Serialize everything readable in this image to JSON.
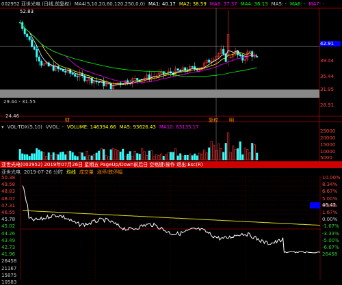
{
  "kline": {
    "stock": "002952 亚世光电 (日线,前复权)",
    "ma4": "MA4(5,10,20,60,120,250,0,0)",
    "ma1": "MA1: 40.17",
    "ma2": "MA2: 38.59",
    "ma3": "MA3: 37.37",
    "ma4v": "MA4: 36.13",
    "ma5": "MA5: -",
    "ma6": "MA6: -",
    "ma7": "MA7: -",
    "high_mark": "52.83",
    "low_mark": "24.46",
    "range_mark": "29.44 - 31.55",
    "price_axis": [
      "42.91",
      "39.44",
      "35.44",
      "31.95",
      "28.91"
    ],
    "current_price": "42.91",
    "cai_label": "财",
    "fu_label": "复权",
    "ming_label": "明"
  },
  "volume": {
    "title": "VOL-TDX(5,10)",
    "vvol": "VVOL: -",
    "volume": "VOLUME: 146394.66",
    "ma5": "MA5: 93626.43",
    "ma10": "MA10: 63135.17",
    "axis": [
      "25000",
      "20000",
      "15000",
      "10000",
      "5000"
    ]
  },
  "intraday_bar": {
    "text": "亚世光电(002952) 2019年07月26日 星期五 PageUp/Down前后日 空格键:操作 退出:Esc(R)"
  },
  "intraday": {
    "name": "亚世光电",
    "time": "2019-07-26 分时",
    "jx": "均线",
    "cjl": "成交量",
    "zdf": "涨停/跌停幅",
    "left_axis": [
      "50.38",
      "49.58",
      "48.83",
      "48.07",
      "47.31",
      "46.55",
      "45.78",
      "45.02",
      "44.26",
      "43.49",
      "42.73",
      "41.96",
      "26458",
      "21167",
      "15875",
      "10583"
    ],
    "right_axis": [
      "10.00%",
      "8.34%",
      "6.67%",
      "5.00%",
      "3.33%",
      "1.67%",
      "0.00%",
      "-1.67%",
      "-3.33%",
      "-5.00%",
      "-6.67%",
      "26458"
    ],
    "current": "46.42"
  },
  "colors": {
    "up": "#ff3333",
    "down": "#33ffff",
    "ma1": "#ffffff",
    "ma2": "#ffff00",
    "ma3": "#ff00ff",
    "ma4": "#00ff00",
    "header_red": "#cc0000"
  }
}
